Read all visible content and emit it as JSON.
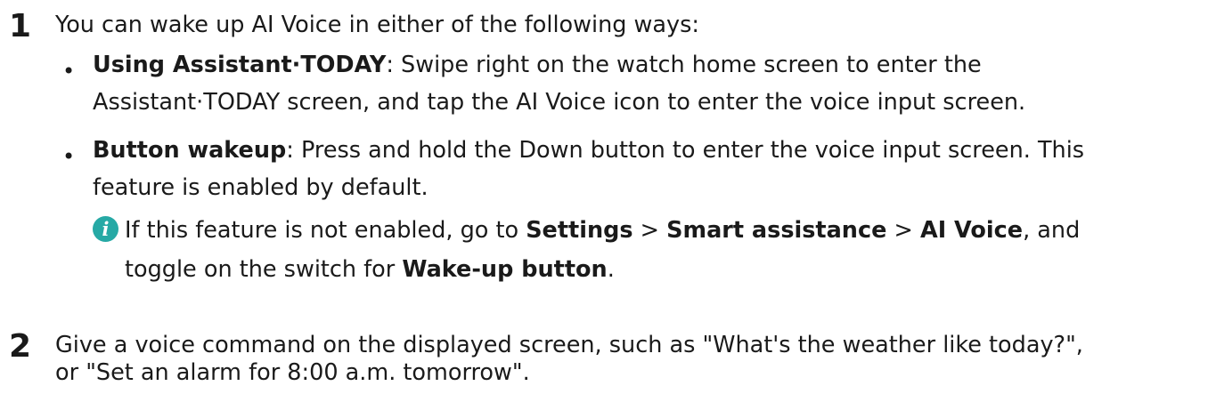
{
  "step1": {
    "number": "1",
    "text": "You can wake up AI Voice in either of the following ways:"
  },
  "bullets": [
    {
      "dot": "•",
      "title": "Using Assistant·TODAY",
      "line1_rest": ": Swipe right on the watch home screen to enter the",
      "line2": "Assistant·TODAY screen, and tap the AI Voice icon to enter the voice input screen."
    },
    {
      "dot": "•",
      "title": "Button wakeup",
      "line1_rest": ": Press and hold the Down button to enter the voice input screen. This",
      "line2": "feature is enabled by default."
    }
  ],
  "note": {
    "icon": "info-icon",
    "icon_glyph": "i",
    "icon_color": "#26a9a5",
    "prefix": "If this feature is not enabled, go to ",
    "settings": "Settings",
    "sep1": " > ",
    "smart_assistance": "Smart assistance",
    "sep2": " > ",
    "ai_voice": "AI Voice",
    "comma": ", and",
    "line2_prefix": "toggle on the switch for ",
    "wake_up_button": "Wake-up button",
    "period": "."
  },
  "step2": {
    "number": "2",
    "line1": "Give a voice command on the displayed screen, such as \"What's the weather like today?\",",
    "line2": "or \"Set an alarm for 8:00 a.m. tomorrow\"."
  }
}
